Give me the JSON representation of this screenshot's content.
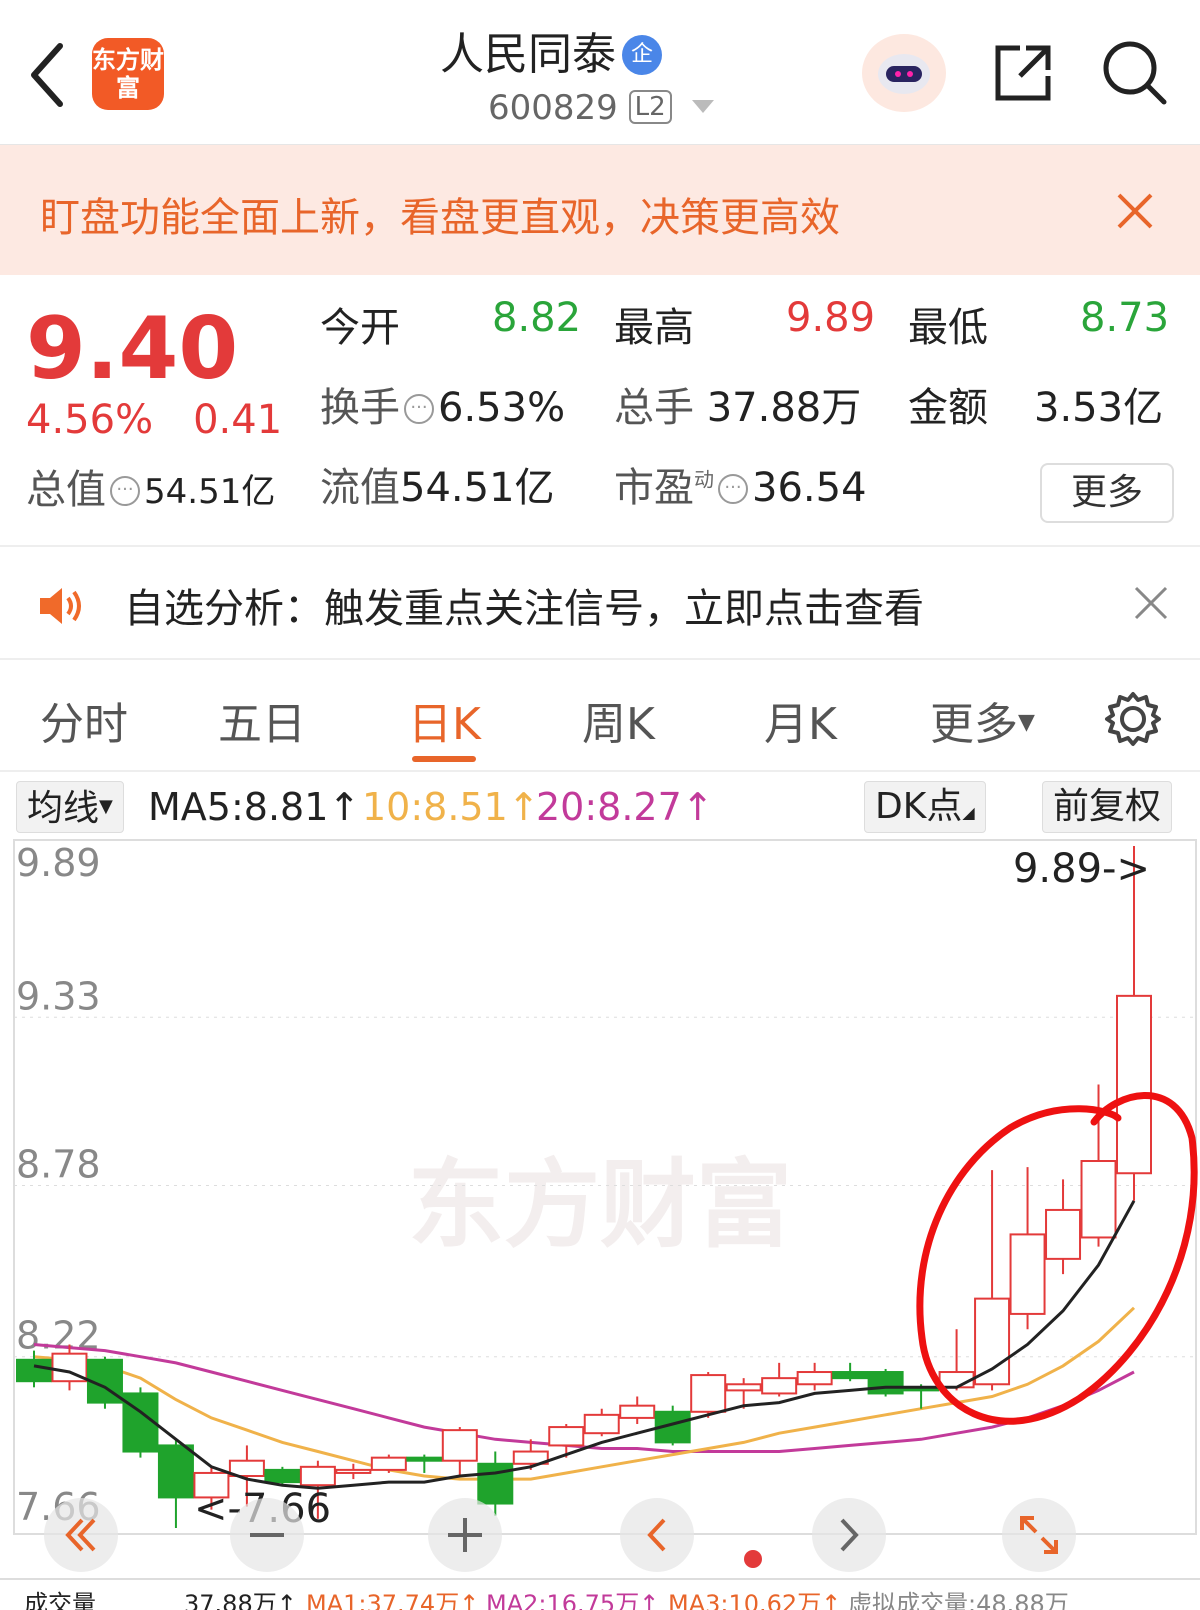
{
  "header": {
    "app_logo_text": "东方财富",
    "stock_name": "人民同泰",
    "badge": "企",
    "stock_code": "600829",
    "level": "L2"
  },
  "banner": {
    "text": "盯盘功能全面上新，看盘更直观，决策更高效"
  },
  "quote": {
    "price": "9.40",
    "change_pct": "4.56%",
    "change_amt": "0.41",
    "open_label": "今开",
    "open": "8.82",
    "high_label": "最高",
    "high": "9.89",
    "low_label": "最低",
    "low": "8.73",
    "turnover_label": "换手",
    "turnover": "6.53%",
    "volume_label": "总手",
    "volume": "37.88万",
    "amount_label": "金额",
    "amount": "3.53亿",
    "mktcap_label": "总值",
    "mktcap": "54.51亿",
    "float_label": "流值",
    "float": "54.51亿",
    "pe_label": "市盈",
    "pe_sup": "动",
    "pe": "36.54",
    "more": "更多"
  },
  "notice": {
    "text": "自选分析：触发重点关注信号，立即点击查看"
  },
  "tabs": [
    "分时",
    "五日",
    "日K",
    "周K",
    "月K",
    "更多"
  ],
  "active_tab": "日K",
  "chart_head": {
    "ma_selector": "均线",
    "ma5": "MA5:8.81↑",
    "ma10": "10:8.51↑",
    "ma20": "20:8.27↑",
    "dk": "DK点",
    "adjust": "前复权"
  },
  "colors": {
    "up": "#e33a3a",
    "down": "#1fa32c",
    "accent": "#e8652a",
    "ma5": "#222222",
    "ma10": "#f0b24a",
    "ma20": "#c23a9a"
  },
  "chart_data": {
    "type": "candlestick",
    "y_ticks": [
      "9.89",
      "9.33",
      "8.78",
      "8.22",
      "7.66"
    ],
    "ylim": [
      7.66,
      9.89
    ],
    "max_label": "9.89->",
    "min_label": "<-7.66",
    "watermark": "东方财富",
    "candles": [
      {
        "o": 8.21,
        "c": 8.14,
        "h": 8.24,
        "l": 8.12
      },
      {
        "o": 8.14,
        "c": 8.23,
        "h": 8.26,
        "l": 8.11
      },
      {
        "o": 8.21,
        "c": 8.07,
        "h": 8.22,
        "l": 8.05
      },
      {
        "o": 8.1,
        "c": 7.91,
        "h": 8.12,
        "l": 7.89
      },
      {
        "o": 7.93,
        "c": 7.76,
        "h": 7.95,
        "l": 7.66
      },
      {
        "o": 7.76,
        "c": 7.84,
        "h": 7.86,
        "l": 7.72
      },
      {
        "o": 7.83,
        "c": 7.88,
        "h": 7.93,
        "l": 7.73
      },
      {
        "o": 7.85,
        "c": 7.81,
        "h": 7.86,
        "l": 7.8
      },
      {
        "o": 7.8,
        "c": 7.86,
        "h": 7.88,
        "l": 7.69
      },
      {
        "o": 7.84,
        "c": 7.85,
        "h": 7.87,
        "l": 7.82
      },
      {
        "o": 7.85,
        "c": 7.89,
        "h": 7.9,
        "l": 7.84
      },
      {
        "o": 7.89,
        "c": 7.88,
        "h": 7.9,
        "l": 7.84
      },
      {
        "o": 7.88,
        "c": 7.98,
        "h": 7.99,
        "l": 7.83
      },
      {
        "o": 7.87,
        "c": 7.74,
        "h": 7.91,
        "l": 7.7
      },
      {
        "o": 7.87,
        "c": 7.91,
        "h": 7.95,
        "l": 7.85
      },
      {
        "o": 7.93,
        "c": 7.99,
        "h": 8.0,
        "l": 7.89
      },
      {
        "o": 7.97,
        "c": 8.03,
        "h": 8.05,
        "l": 7.96
      },
      {
        "o": 8.02,
        "c": 8.06,
        "h": 8.09,
        "l": 8.0
      },
      {
        "o": 8.04,
        "c": 7.94,
        "h": 8.06,
        "l": 7.93
      },
      {
        "o": 8.04,
        "c": 8.16,
        "h": 8.17,
        "l": 8.02
      },
      {
        "o": 8.11,
        "c": 8.13,
        "h": 8.15,
        "l": 8.05
      },
      {
        "o": 8.1,
        "c": 8.15,
        "h": 8.2,
        "l": 8.09
      },
      {
        "o": 8.13,
        "c": 8.17,
        "h": 8.2,
        "l": 8.11
      },
      {
        "o": 8.17,
        "c": 8.15,
        "h": 8.2,
        "l": 8.14
      },
      {
        "o": 8.17,
        "c": 8.1,
        "h": 8.18,
        "l": 8.09
      },
      {
        "o": 8.12,
        "c": 8.11,
        "h": 8.13,
        "l": 8.05
      },
      {
        "o": 8.12,
        "c": 8.17,
        "h": 8.31,
        "l": 8.11
      },
      {
        "o": 8.13,
        "c": 8.41,
        "h": 8.83,
        "l": 8.11
      },
      {
        "o": 8.36,
        "c": 8.62,
        "h": 8.84,
        "l": 8.31
      },
      {
        "o": 8.54,
        "c": 8.7,
        "h": 8.8,
        "l": 8.49
      },
      {
        "o": 8.61,
        "c": 8.86,
        "h": 9.11,
        "l": 8.58
      },
      {
        "o": 8.82,
        "c": 9.4,
        "h": 9.89,
        "l": 8.73
      }
    ],
    "ma5": [
      8.19,
      8.17,
      8.12,
      8.04,
      7.95,
      7.86,
      7.82,
      7.8,
      7.79,
      7.8,
      7.81,
      7.81,
      7.83,
      7.84,
      7.86,
      7.9,
      7.94,
      7.97,
      8.0,
      8.03,
      8.06,
      8.07,
      8.1,
      8.11,
      8.12,
      8.12,
      8.12,
      8.18,
      8.26,
      8.37,
      8.52,
      8.73
    ],
    "ma10": [
      8.22,
      8.21,
      8.19,
      8.15,
      8.08,
      8.02,
      7.98,
      7.94,
      7.91,
      7.88,
      7.85,
      7.83,
      7.82,
      7.82,
      7.82,
      7.84,
      7.86,
      7.88,
      7.9,
      7.92,
      7.94,
      7.97,
      7.99,
      8.01,
      8.03,
      8.05,
      8.07,
      8.09,
      8.13,
      8.19,
      8.27,
      8.38
    ],
    "ma20": [
      8.26,
      8.25,
      8.24,
      8.22,
      8.2,
      8.17,
      8.14,
      8.11,
      8.08,
      8.05,
      8.02,
      7.99,
      7.97,
      7.95,
      7.94,
      7.93,
      7.92,
      7.92,
      7.91,
      7.91,
      7.91,
      7.91,
      7.92,
      7.93,
      7.94,
      7.95,
      7.97,
      7.99,
      8.02,
      8.06,
      8.11,
      8.17
    ]
  },
  "volume_bar": {
    "label": "成交量",
    "vol": "37.88万↑",
    "ma1": "MA1:37.74万↑",
    "ma2": "MA2:16.75万↑",
    "ma3": "MA3:10.62万↑",
    "virtual": "虚拟成交量:48.88万"
  }
}
